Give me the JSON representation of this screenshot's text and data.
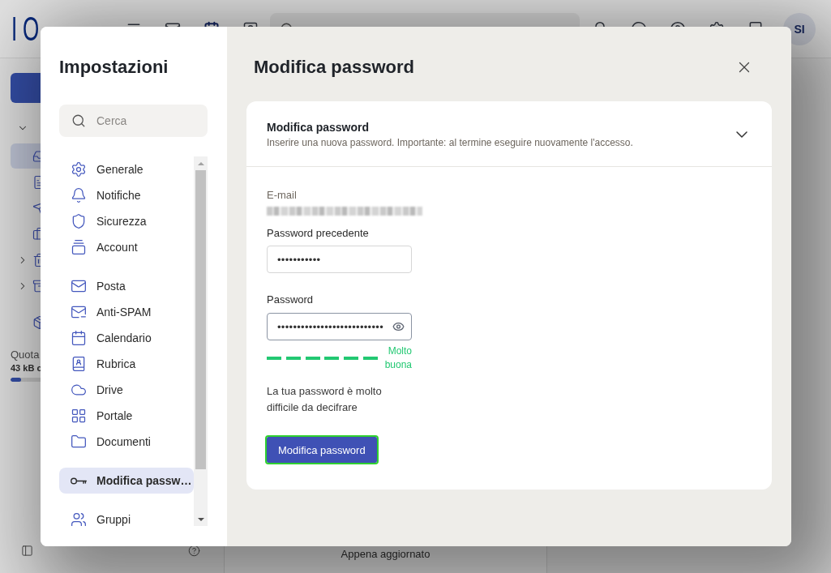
{
  "app": {
    "logo": "IO",
    "avatar": "SI",
    "sidebar": {
      "mailbox": {
        "expanded": true
      },
      "folder_groups": [
        {
          "folders": [
            {
              "selected": true,
              "has_children": false
            },
            {
              "selected": false,
              "has_children": false
            },
            {
              "selected": false,
              "has_children": false
            },
            {
              "selected": false,
              "has_children": false
            },
            {
              "selected": false,
              "has_children": true
            },
            {
              "selected": false,
              "has_children": true
            }
          ]
        },
        {
          "folders": [
            {
              "selected": false,
              "has_children": false
            }
          ]
        }
      ],
      "quota": {
        "label": "Quota",
        "usage": "43 kB c",
        "level": 0.05
      }
    },
    "status": "Appena aggiornato"
  },
  "settings": {
    "title": "Impostazioni",
    "search": {
      "placeholder": "Cerca"
    },
    "nav_groups": [
      {
        "items": [
          {
            "label": "Generale",
            "selected": false
          },
          {
            "label": "Notifiche",
            "selected": false
          },
          {
            "label": "Sicurezza",
            "selected": false
          },
          {
            "label": "Account",
            "selected": false
          }
        ]
      },
      {
        "items": [
          {
            "label": "Posta",
            "selected": false
          },
          {
            "label": "Anti-SPAM",
            "selected": false
          },
          {
            "label": "Calendario",
            "selected": false
          },
          {
            "label": "Rubrica",
            "selected": false
          },
          {
            "label": "Drive",
            "selected": false
          },
          {
            "label": "Portale",
            "selected": false
          },
          {
            "label": "Documenti",
            "selected": false
          }
        ]
      },
      {
        "items": [
          {
            "label": "Modifica passw…",
            "selected": true
          }
        ]
      },
      {
        "items": [
          {
            "label": "Gruppi",
            "selected": false
          }
        ]
      }
    ]
  },
  "page": {
    "title": "Modifica password",
    "section": {
      "title": "Modifica password",
      "description": "Inserire una nuova password. Importante: al termine eseguire nuovamente l'accesso.",
      "expanded": true,
      "email": {
        "label": "E-mail"
      },
      "fields": [
        {
          "label": "Password precedente",
          "value": "•••••••••••",
          "focused": false,
          "reveal_button": false
        },
        {
          "label": "Password",
          "value": "•••••••••••••••••••••••••••",
          "focused": true,
          "reveal_button": true
        }
      ],
      "strength": {
        "level": 1,
        "label": "Molto buona"
      },
      "hint": "La tua password è molto difficile da decifrare",
      "submit": {
        "label": "Modifica password",
        "outlined": true
      }
    }
  }
}
